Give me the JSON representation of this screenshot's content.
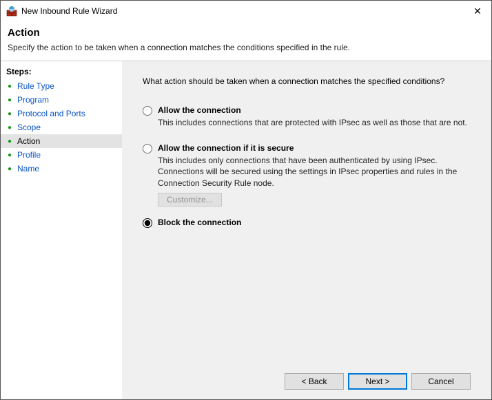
{
  "window": {
    "title": "New Inbound Rule Wizard"
  },
  "header": {
    "title": "Action",
    "subtitle": "Specify the action to be taken when a connection matches the conditions specified in the rule."
  },
  "sidebar": {
    "title": "Steps:",
    "items": [
      {
        "label": "Rule Type"
      },
      {
        "label": "Program"
      },
      {
        "label": "Protocol and Ports"
      },
      {
        "label": "Scope"
      },
      {
        "label": "Action"
      },
      {
        "label": "Profile"
      },
      {
        "label": "Name"
      }
    ]
  },
  "main": {
    "prompt": "What action should be taken when a connection matches the specified conditions?",
    "options": {
      "allow": {
        "label": "Allow the connection",
        "desc": "This includes connections that are protected with IPsec as well as those that are not."
      },
      "allow_secure": {
        "label": "Allow the connection if it is secure",
        "desc": "This includes only connections that have been authenticated by using IPsec.  Connections will be secured using the settings in IPsec properties and rules in the Connection Security Rule node.",
        "customize": "Customize..."
      },
      "block": {
        "label": "Block the connection"
      }
    }
  },
  "footer": {
    "back": "< Back",
    "next": "Next >",
    "cancel": "Cancel"
  }
}
